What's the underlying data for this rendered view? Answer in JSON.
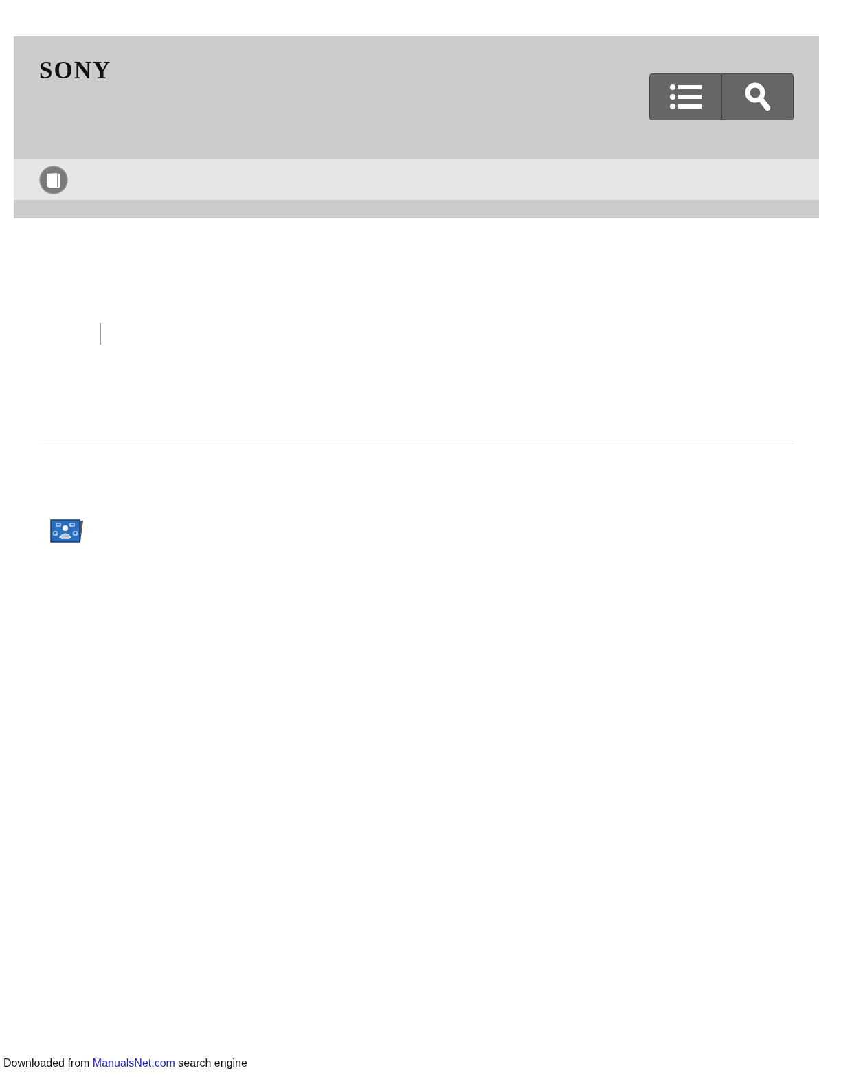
{
  "header": {
    "logo": "SONY"
  },
  "footer": {
    "text_before": "Downloaded from",
    "link": "ManualsNet.com",
    "text_after": "search engine"
  }
}
